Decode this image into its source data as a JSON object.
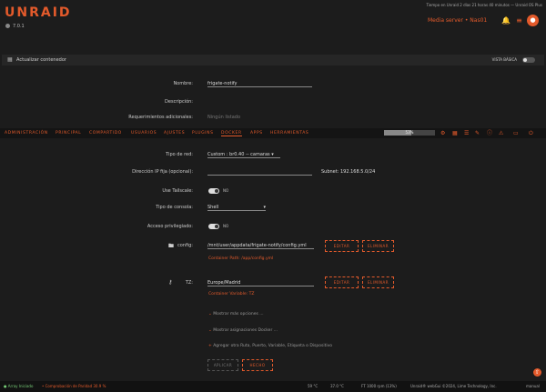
{
  "header": {
    "logo": "UNRAID",
    "version": "7.0.1",
    "uptime": "Tiempo en Unraid 2 días 21 horas 40 minutos — Unraid OS Plus",
    "server_label": "Media server • Nas01",
    "accent": "#e35a2b"
  },
  "titlebar": {
    "title": "Actualizar contenedor",
    "basic_view": "VISTA BÁSICA"
  },
  "form": {
    "name_label": "Nombre:",
    "name_value": "frigate-notify",
    "description_label": "Descripción:",
    "extra_req_label": "Requerimientos adicionales:",
    "extra_req_value": "Ningún listado",
    "network_label": "Tipo de red:",
    "network_value": "Custom : br0.40 -- camaras",
    "fixed_ip_label": "Dirección IP fija (opcional):",
    "subnet": "Subnet: 192.168.5.0/24",
    "tailscale_label": "Use Tailscale:",
    "tailscale_state": "NO",
    "console_label": "Tipo de consola:",
    "console_value": "Shell",
    "privileged_label": "Acceso privilegiado:",
    "privileged_state": "NO",
    "config_label": "config:",
    "config_value": "/mnt/user/appdata/frigate-notify/config.yml",
    "config_hint": "Container Path: /app/config.yml",
    "tz_label": "TZ:",
    "tz_value": "Europe/Madrid",
    "tz_hint": "Container Variable: TZ",
    "edit_label": "EDITAR",
    "remove_label": "ELIMINAR",
    "show_more": "Mostrar más opciones ...",
    "show_docker": "Mostrar asignaciones Docker ...",
    "add_path": "Agregar otra Ruta, Puerto, Variable, Etiqueta o Dispositivo",
    "apply_label": "APLICAR",
    "done_label": "HECHO"
  },
  "nav": {
    "items": [
      "ADMINISTRACIÓN",
      "PRINCIPAL",
      "COMPARTIDO",
      "USUARIOS",
      "AJUSTES",
      "PLUGINS",
      "DOCKER",
      "APPS",
      "HERRAMIENTAS"
    ],
    "active": "DOCKER",
    "cpu_percent": 53,
    "cpu_text": "53%"
  },
  "footer": {
    "array_status": "Array Iniciado",
    "parity": "Comprobación de Paridad 30.9 %",
    "temp1": "59 °C",
    "temp2": "37.0 °C",
    "fan": "FT 1000 rpm (13%)",
    "copyright": "Unraid® webGui ©2024, Lime Technology, Inc.",
    "manual": "manual"
  },
  "icons": [
    "circle-icon",
    "bell-icon",
    "menu-icon",
    "avatar-icon",
    "folder-icon",
    "key-icon",
    "plus-icon",
    "chevron-down-icon",
    "arrow-up-icon"
  ]
}
